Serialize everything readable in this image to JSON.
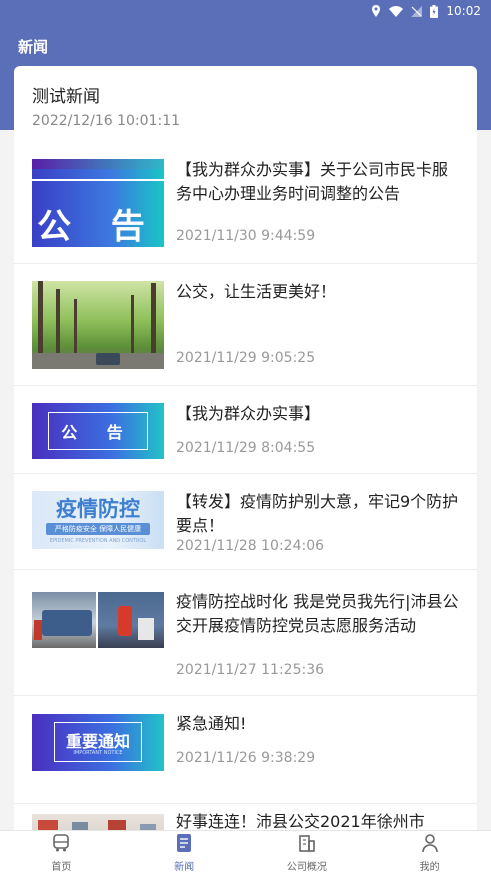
{
  "status": {
    "time": "10:02"
  },
  "appbar": {
    "title": "新闻"
  },
  "header_news": {
    "title": "测试新闻",
    "date": "2022/12/16 10:01:11"
  },
  "news": [
    {
      "title": "【我为群众办实事】关于公司市民卡服务中心办理业务时间调整的公告",
      "date": "2021/11/30 9:44:59",
      "thumb_text": "公 告"
    },
    {
      "title": "公交，让生活更美好！",
      "date": "2021/11/29 9:05:25"
    },
    {
      "title": "【我为群众办实事】",
      "date": "2021/11/29 8:04:55",
      "thumb_text": "公 告"
    },
    {
      "title": "【转发】疫情防护别大意，牢记9个防护要点！",
      "date": "2021/11/28 10:24:06",
      "thumb_text": "疫情防控",
      "thumb_sub": "严格防疫安全 保障人民健康",
      "thumb_foot": "EPIDEMIC PREVENTION AND CONTROL"
    },
    {
      "title": "疫情防控战时化 我是党员我先行|沛县公交开展疫情防控党员志愿服务活动",
      "date": "2021/11/27 11:25:36"
    },
    {
      "title": "紧急通知!",
      "date": "2021/11/26 9:38:29",
      "thumb_text": "重要通知",
      "thumb_foot": "IMPORTANT NOTICE"
    },
    {
      "title": "好事连连！沛县公交2021年徐州市",
      "date": ""
    }
  ],
  "tabs": [
    {
      "label": "首页",
      "icon": "bus-icon"
    },
    {
      "label": "新闻",
      "icon": "news-icon"
    },
    {
      "label": "公司概况",
      "icon": "building-icon"
    },
    {
      "label": "我的",
      "icon": "user-icon"
    }
  ],
  "colors": {
    "primary": "#5b6fb8"
  }
}
